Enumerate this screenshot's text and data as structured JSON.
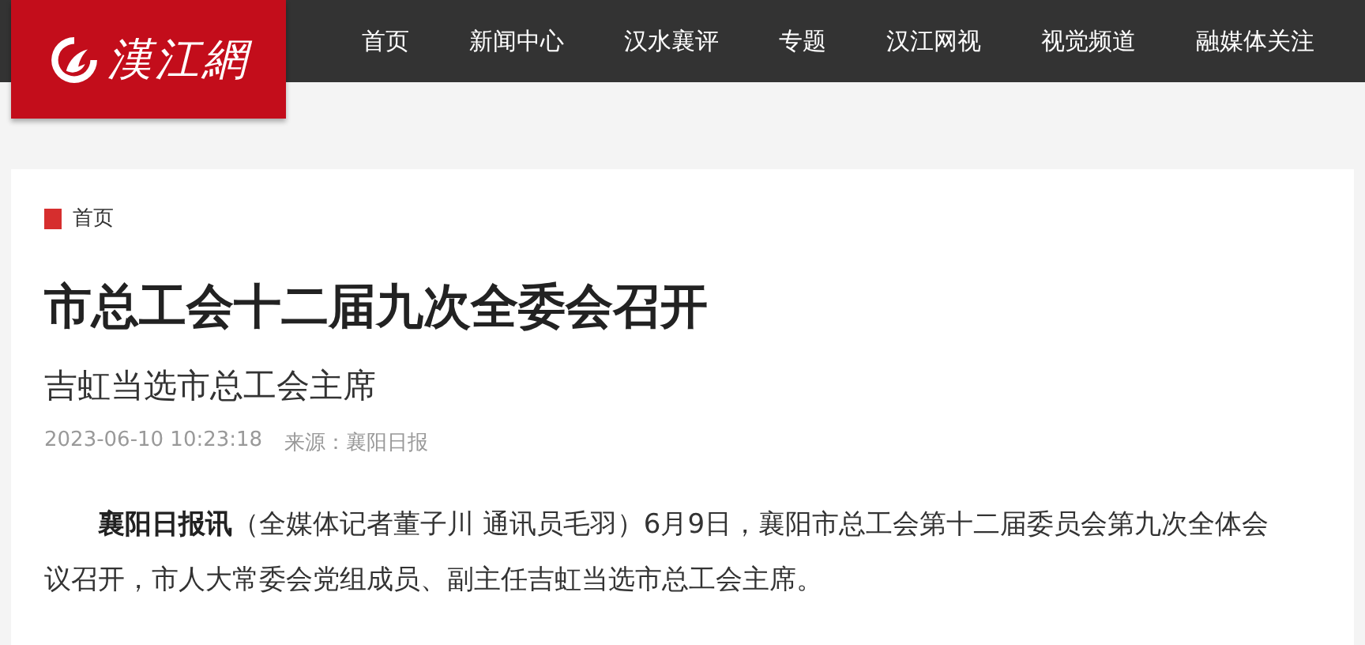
{
  "logo": {
    "text": "漢江網"
  },
  "nav": [
    {
      "label": "首页"
    },
    {
      "label": "新闻中心"
    },
    {
      "label": "汉水襄评"
    },
    {
      "label": "专题"
    },
    {
      "label": "汉江网视"
    },
    {
      "label": "视觉频道"
    },
    {
      "label": "融媒体关注"
    }
  ],
  "breadcrumb": "首页",
  "article": {
    "title": "市总工会十二届九次全委会召开",
    "subtitle": "吉虹当选市总工会主席",
    "time": "2023-06-10 10:23:18",
    "source": "来源：襄阳日报",
    "paragraph": "**襄阳日报讯**（全媒体记者董子川 通讯员毛羽）6月9日，襄阳市总工会第十二届委员会第九次全体会议召开，市人大常委会党组成员、副主任吉虹当选市总工会主席。"
  }
}
